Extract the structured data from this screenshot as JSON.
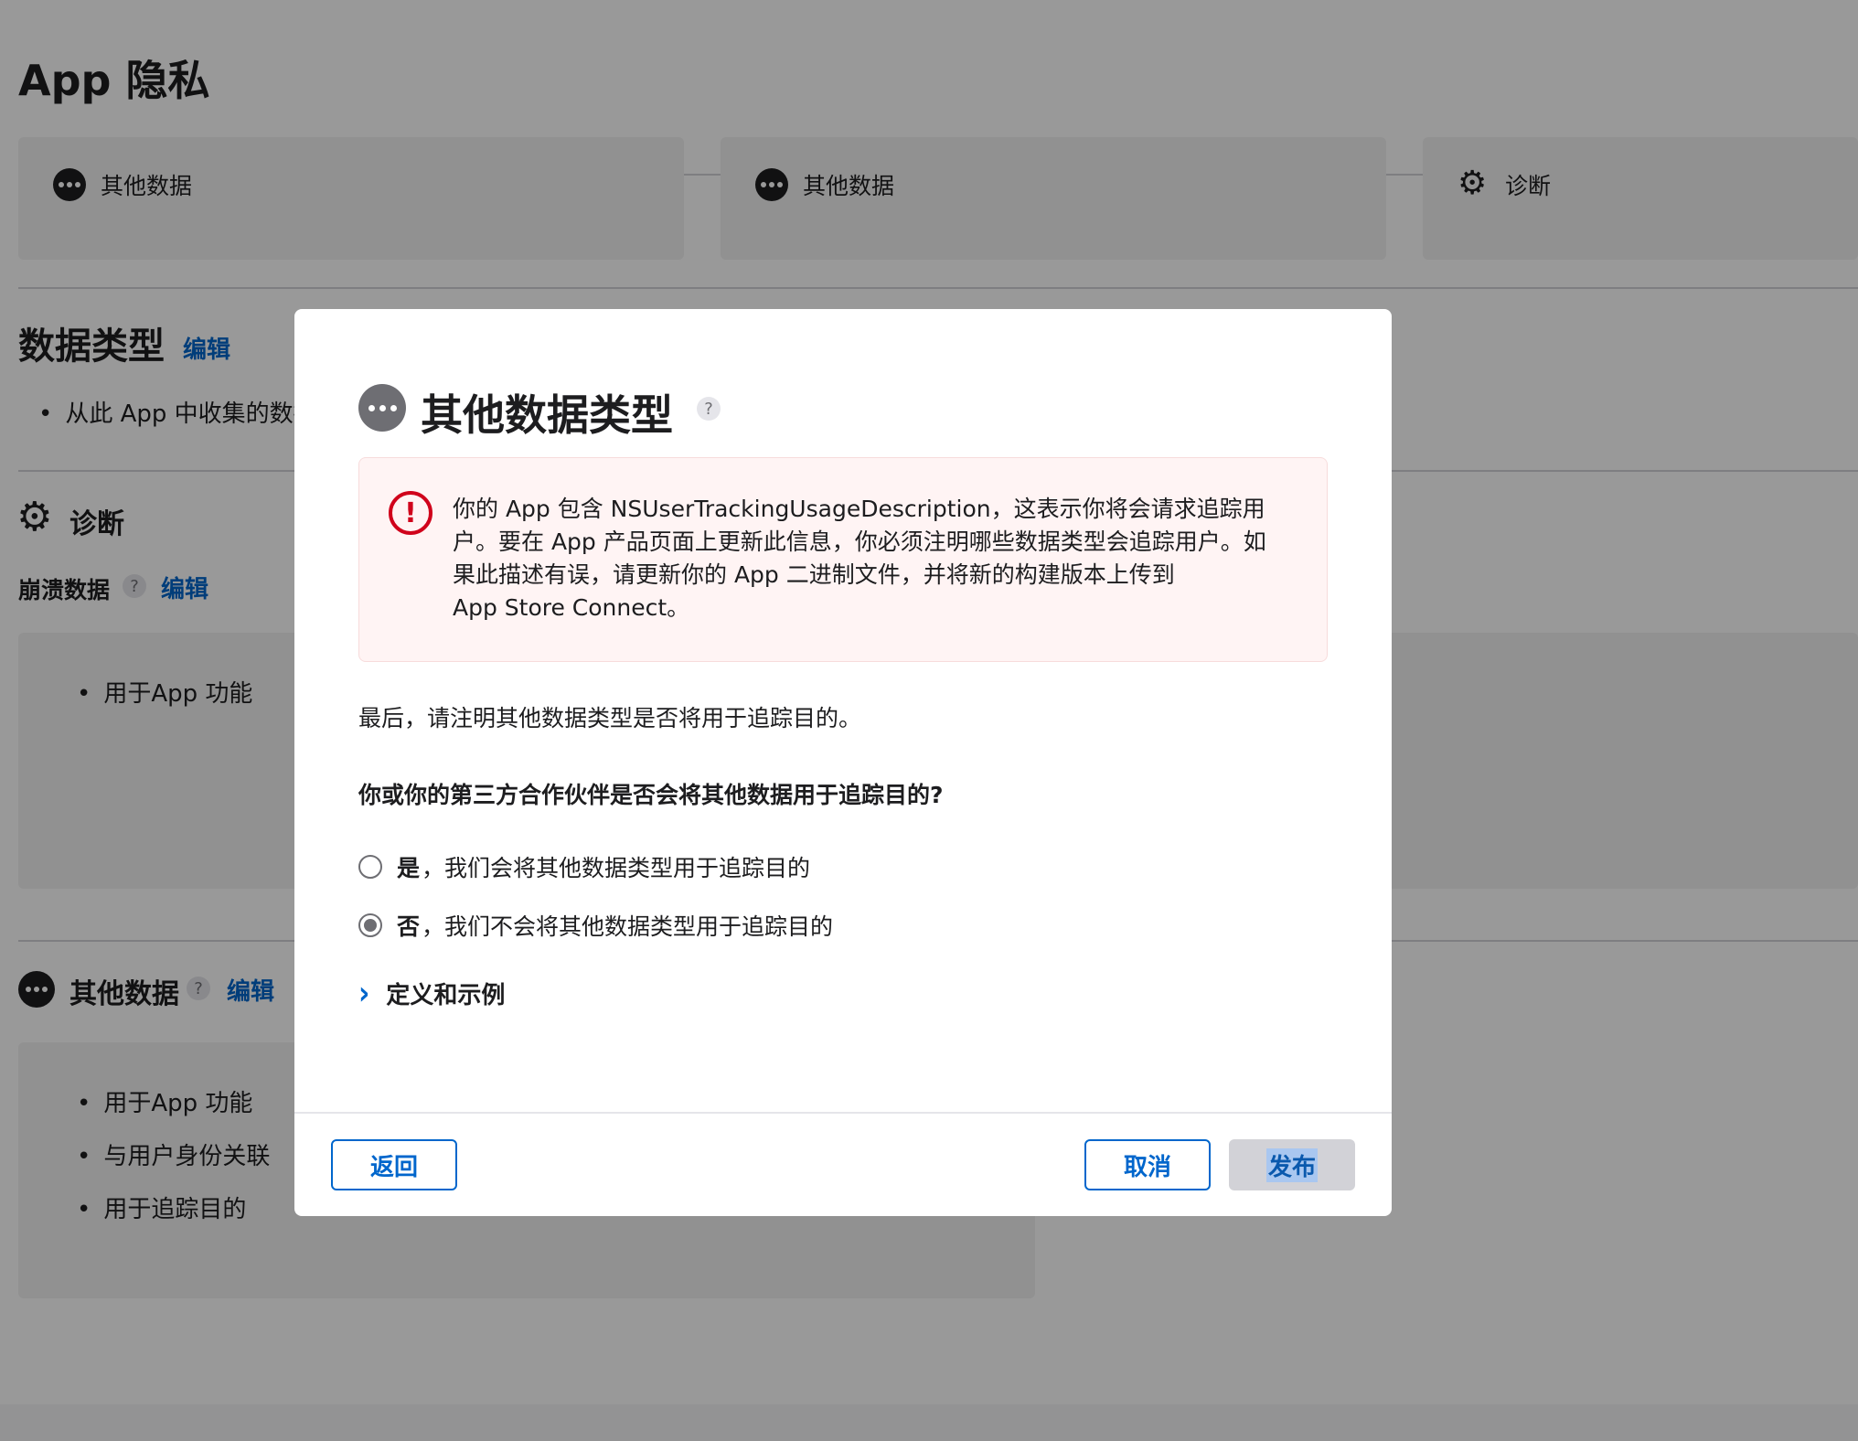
{
  "page": {
    "title": "App 隐私"
  },
  "top_cards": [
    {
      "icon": "more-icon",
      "label": "其他数据"
    },
    {
      "icon": "more-icon",
      "label": "其他数据"
    },
    {
      "icon": "gear-icon",
      "label": "诊断"
    }
  ],
  "data_types": {
    "title": "数据类型",
    "edit": "编辑",
    "bullet": "从此 App 中收集的数据"
  },
  "diagnostics": {
    "title": "诊断",
    "crash": {
      "label": "崩溃数据",
      "help": "?",
      "edit": "编辑",
      "bullets": [
        "用于App 功能"
      ]
    }
  },
  "other_data": {
    "title": "其他数据",
    "help": "?",
    "edit": "编辑",
    "bullets": [
      "用于App 功能",
      "与用户身份关联",
      "用于追踪目的"
    ]
  },
  "modal": {
    "title": "其他数据类型",
    "help": "?",
    "alert": {
      "line1": "你的 App 包含 NSUserTrackingUsageDescription，这表示你将会请求追踪用",
      "line2": "户。要在 App 产品页面上更新此信息，你必须注明哪些数据类型会追踪用户。如",
      "line3": "果此描述有误，请更新你的 App 二进制文件，并将新的构建版本上传到",
      "line4": "App Store Connect。"
    },
    "lead": "最后，请注明其他数据类型是否将用于追踪目的。",
    "question": "你或你的第三方合作伙伴是否会将其他数据用于追踪目的?",
    "options": [
      {
        "strong": "是",
        "rest": "，我们会将其他数据类型用于追踪目的",
        "checked": false
      },
      {
        "strong": "否",
        "rest": "，我们不会将其他数据类型用于追踪目的",
        "checked": true
      }
    ],
    "disclosure": "定义和示例",
    "buttons": {
      "back": "返回",
      "cancel": "取消",
      "publish": "发布"
    }
  },
  "colors": {
    "link": "#0066cc",
    "error": "#d0021b",
    "overlay": "rgba(0,0,0,0.4)"
  }
}
